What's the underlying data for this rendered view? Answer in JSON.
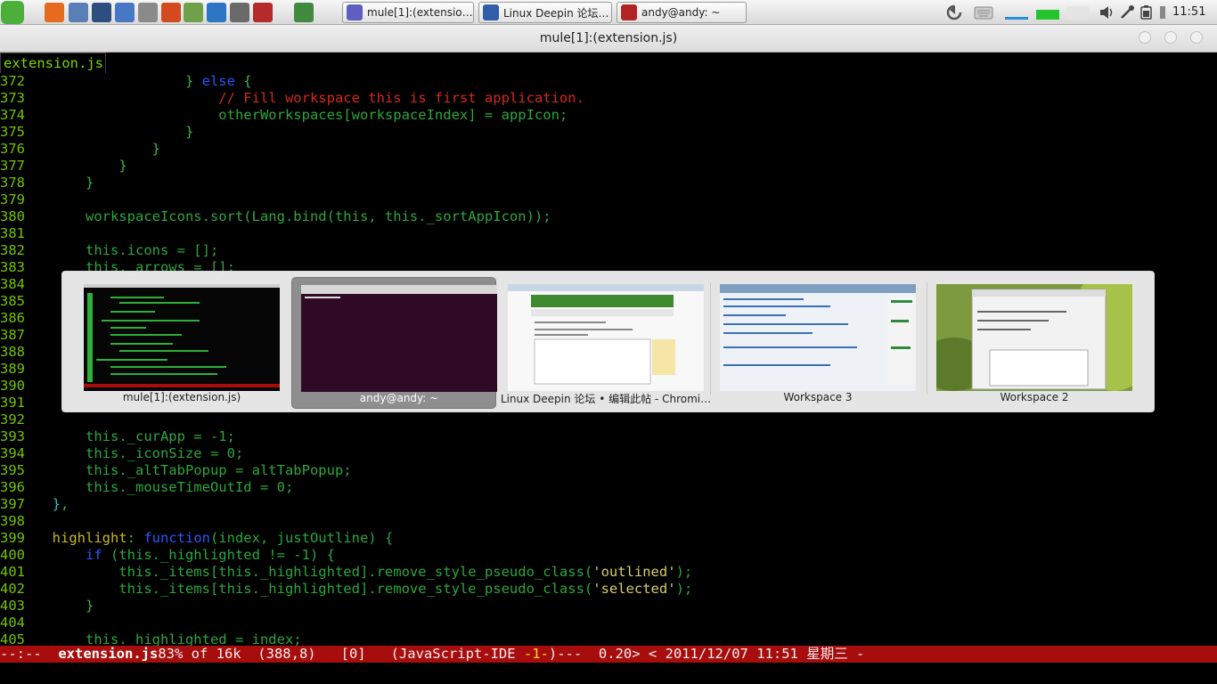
{
  "panel": {
    "launchers": [
      {
        "name": "deepin-logo-icon",
        "color": "#4caf3a"
      },
      {
        "name": "firefox-icon",
        "color": "#e66b1e"
      },
      {
        "name": "file-manager-icon",
        "color": "#5a7fb8"
      },
      {
        "name": "terminal-launcher-icon",
        "color": "#2d4e7e"
      },
      {
        "name": "document-icon",
        "color": "#4778c6"
      },
      {
        "name": "disk-icon",
        "color": "#8a8a8a"
      },
      {
        "name": "music-player-icon",
        "color": "#d34a1f"
      },
      {
        "name": "network-icon",
        "color": "#6fa14a"
      },
      {
        "name": "update-manager-icon",
        "color": "#2e74c4"
      },
      {
        "name": "media-player-icon",
        "color": "#6a6a6a"
      },
      {
        "name": "app-grid-icon",
        "color": "#b52a2a"
      },
      {
        "name": "editor-launcher-icon",
        "color": "#3f8a3f"
      }
    ],
    "tasks": [
      {
        "label": "mule[1]:(extensio…",
        "icon": "emacs-icon",
        "color": "#5f5fc2"
      },
      {
        "label": "Linux Deepin 论坛…",
        "icon": "chromium-icon",
        "color": "#2e5fa8"
      },
      {
        "label": "andy@andy: ~",
        "icon": "terminal-icon",
        "color": "#b22424"
      }
    ],
    "clock": "11:51"
  },
  "window": {
    "title": "mule[1]:(extension.js)"
  },
  "editor": {
    "buffer_tab": "extension.js",
    "lines": [
      {
        "n": "372",
        "segs": [
          [
            "pl",
            "                  } "
          ],
          [
            "kw",
            "else"
          ],
          [
            "pl",
            " {"
          ]
        ]
      },
      {
        "n": "373",
        "segs": [
          [
            "cm",
            "                      // Fill workspace this is first application."
          ]
        ]
      },
      {
        "n": "374",
        "segs": [
          [
            "code",
            "                      otherWorkspaces[workspaceIndex] = appIcon;"
          ]
        ]
      },
      {
        "n": "375",
        "segs": [
          [
            "pl",
            "                  }"
          ]
        ]
      },
      {
        "n": "376",
        "segs": [
          [
            "pl",
            "              }"
          ]
        ]
      },
      {
        "n": "377",
        "segs": [
          [
            "pl",
            "          }"
          ]
        ]
      },
      {
        "n": "378",
        "segs": [
          [
            "pl",
            "      }"
          ]
        ]
      },
      {
        "n": "379",
        "segs": [
          [
            "code",
            ""
          ]
        ]
      },
      {
        "n": "380",
        "segs": [
          [
            "code",
            "      workspaceIcons.sort(Lang.bind(this, this._sortAppIcon));"
          ]
        ]
      },
      {
        "n": "381",
        "segs": [
          [
            "code",
            ""
          ]
        ]
      },
      {
        "n": "382",
        "segs": [
          [
            "code",
            "      this.icons = [];"
          ]
        ]
      },
      {
        "n": "383",
        "segs": [
          [
            "code",
            "      this._arrows = [];"
          ]
        ]
      },
      {
        "n": "384",
        "segs": [
          [
            "code",
            ""
          ]
        ]
      },
      {
        "n": "385",
        "segs": [
          [
            "code",
            ""
          ]
        ]
      },
      {
        "n": "386",
        "segs": [
          [
            "code",
            ""
          ]
        ]
      },
      {
        "n": "387",
        "segs": [
          [
            "code",
            ""
          ]
        ]
      },
      {
        "n": "388",
        "segs": [
          [
            "code",
            ""
          ]
        ]
      },
      {
        "n": "389",
        "segs": [
          [
            "code",
            ""
          ]
        ]
      },
      {
        "n": "390",
        "segs": [
          [
            "code",
            ""
          ]
        ]
      },
      {
        "n": "391",
        "segs": [
          [
            "code",
            ""
          ]
        ]
      },
      {
        "n": "392",
        "segs": [
          [
            "code",
            ""
          ]
        ]
      },
      {
        "n": "393",
        "segs": [
          [
            "code",
            "      this._curApp = -1;"
          ]
        ]
      },
      {
        "n": "394",
        "segs": [
          [
            "code",
            "      this._iconSize = 0;"
          ]
        ]
      },
      {
        "n": "395",
        "segs": [
          [
            "code",
            "      this._altTabPopup = altTabPopup;"
          ]
        ]
      },
      {
        "n": "396",
        "segs": [
          [
            "code",
            "      this._mouseTimeOutId = 0;"
          ]
        ]
      },
      {
        "n": "397",
        "segs": [
          [
            "brc",
            "  }"
          ],
          [
            "pl",
            ","
          ]
        ]
      },
      {
        "n": "398",
        "segs": [
          [
            "code",
            ""
          ]
        ]
      },
      {
        "n": "399",
        "segs": [
          [
            "prop",
            "  highlight"
          ],
          [
            "pl",
            ": "
          ],
          [
            "kw",
            "function"
          ],
          [
            "code",
            "(index, justOutline) {"
          ]
        ]
      },
      {
        "n": "400",
        "segs": [
          [
            "kw",
            "      if"
          ],
          [
            "code",
            " (this._highlighted != -1) {"
          ]
        ]
      },
      {
        "n": "401",
        "segs": [
          [
            "code",
            "          this._items[this._highlighted].remove_style_pseudo_class("
          ],
          [
            "st",
            "'outlined'"
          ],
          [
            "code",
            ");"
          ]
        ]
      },
      {
        "n": "402",
        "segs": [
          [
            "code",
            "          this._items[this._highlighted].remove_style_pseudo_class("
          ],
          [
            "st",
            "'selected'"
          ],
          [
            "code",
            ");"
          ]
        ]
      },
      {
        "n": "403",
        "segs": [
          [
            "pl",
            "      }"
          ]
        ]
      },
      {
        "n": "404",
        "segs": [
          [
            "code",
            ""
          ]
        ]
      },
      {
        "n": "405",
        "segs": [
          [
            "code",
            "      this._highlighted = index;"
          ]
        ]
      }
    ]
  },
  "modeline": {
    "prefix": "--:--  ",
    "buffer": "extension.js",
    "position": "83% of 16k  (388,8)   [0]   (JavaScript-IDE ",
    "mark": "-1-",
    "rest": ")---  0.20> < 2011/12/07 11:51 星期三 -"
  },
  "alttab": {
    "items": [
      {
        "label": "mule[1]:(extension.js)",
        "selected": false,
        "thumb": "editor"
      },
      {
        "label": "andy@andy: ~",
        "selected": true,
        "thumb": "terminal"
      },
      {
        "label": "Linux Deepin 论坛 • 编辑此帖 - Chromi…",
        "selected": false,
        "thumb": "browser"
      },
      {
        "label": "Workspace 3",
        "selected": false,
        "thumb": "workspace3"
      },
      {
        "label": "Workspace 2",
        "selected": false,
        "thumb": "workspace2"
      }
    ]
  }
}
